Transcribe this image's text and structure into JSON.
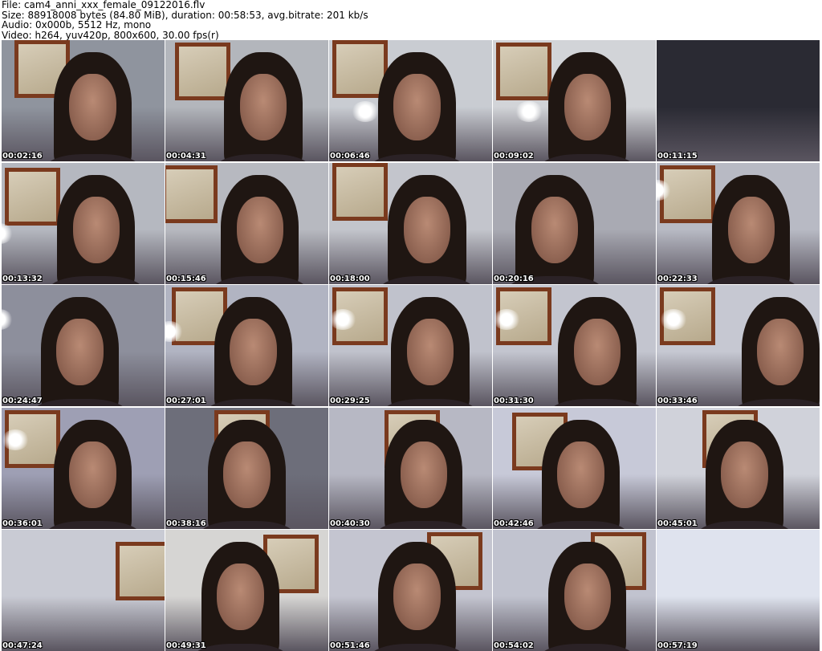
{
  "header": {
    "file": "File: cam4_anni_xxx_female_09122016.flv",
    "size": "Size: 88918008 bytes (84.80 MiB), duration: 00:58:53, avg.bitrate: 201 kb/s",
    "audio": "Audio: 0x000b, 5512 Hz, mono",
    "video": "Video: h264, yuv420p, 800x600, 30.00 fps(r)"
  },
  "thumbnails": [
    {
      "time": "00:02:16",
      "wall": "#8f949e"
    },
    {
      "time": "00:04:31",
      "wall": "#b3b6bc"
    },
    {
      "time": "00:06:46",
      "wall": "#c9ccd2"
    },
    {
      "time": "00:09:02",
      "wall": "#d2d4d8"
    },
    {
      "time": "00:11:15",
      "wall": "#2a2a33"
    },
    {
      "time": "00:13:32",
      "wall": "#b5b8c0"
    },
    {
      "time": "00:15:46",
      "wall": "#b7b9c0"
    },
    {
      "time": "00:18:00",
      "wall": "#c3c5cc"
    },
    {
      "time": "00:20:16",
      "wall": "#a9aab3"
    },
    {
      "time": "00:22:33",
      "wall": "#b8bac4"
    },
    {
      "time": "00:24:47",
      "wall": "#8d8f9c"
    },
    {
      "time": "00:27:01",
      "wall": "#b1b4c2"
    },
    {
      "time": "00:29:25",
      "wall": "#c0c2cc"
    },
    {
      "time": "00:31:30",
      "wall": "#c3c5cf"
    },
    {
      "time": "00:33:46",
      "wall": "#c6c8d2"
    },
    {
      "time": "00:36:01",
      "wall": "#9e9fb4"
    },
    {
      "time": "00:38:16",
      "wall": "#6d6e7a"
    },
    {
      "time": "00:40:30",
      "wall": "#b7b8c4"
    },
    {
      "time": "00:42:46",
      "wall": "#c7c9d8"
    },
    {
      "time": "00:45:01",
      "wall": "#d0d2da"
    },
    {
      "time": "00:47:24",
      "wall": "#c9cbd4"
    },
    {
      "time": "00:49:31",
      "wall": "#d6d5d3"
    },
    {
      "time": "00:51:46",
      "wall": "#c4c5d0"
    },
    {
      "time": "00:54:02",
      "wall": "#c1c3cf"
    },
    {
      "time": "00:57:19",
      "wall": "#dfe3ee"
    }
  ]
}
